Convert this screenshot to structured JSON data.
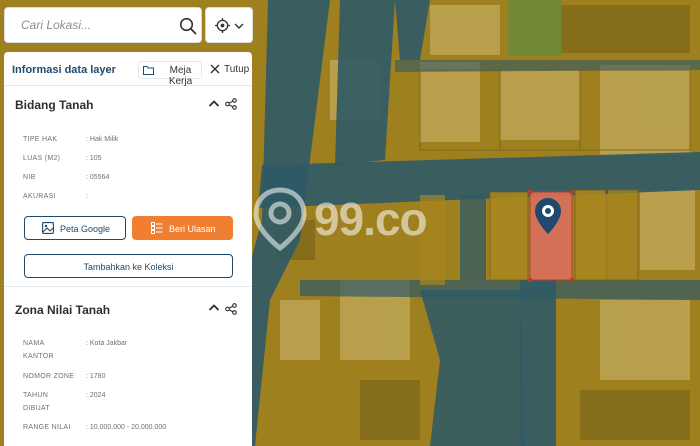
{
  "search": {
    "placeholder": "Cari Lokasi..."
  },
  "panel": {
    "title": "Informasi data layer",
    "workspace_label": "Meja Kerja",
    "close_label": "Tutup"
  },
  "land_parcel": {
    "title": "Bidang Tanah",
    "fields": [
      {
        "label": "TIPE HAK",
        "value": ": Hak Milik"
      },
      {
        "label": "LUAS (M2)",
        "value": ": 105"
      },
      {
        "label": "NIB",
        "value": ": 05564"
      },
      {
        "label": "AKURASI",
        "value": ":"
      }
    ],
    "google_maps_label": "Peta Google",
    "find_listing_label": "Beri Ulasan",
    "add_collection_label": "Tambahkan ke Koleksi"
  },
  "land_value_zone": {
    "title": "Zona Nilai Tanah",
    "fields": [
      {
        "label_1": "NAMA",
        "label_2": "KANTOR",
        "value": ": Kota Jakbar"
      },
      {
        "label_1": "NOMOR ZONE",
        "label_2": "",
        "value": ": 1780"
      },
      {
        "label_1": "TAHUN",
        "label_2": "DIBUAT",
        "value": ": 2024"
      },
      {
        "label_1": "RANGE NILAI",
        "label_2": "",
        "value": ": 10.000.000 - 20.000.000"
      }
    ]
  },
  "map": {
    "watermark": "99.co",
    "icons": {
      "search": "search-icon",
      "location": "location-target-icon",
      "pin": "map-pin-icon"
    },
    "colors": {
      "parcel_tint": "#b8901a",
      "road_tint": "#2f5a66",
      "selected_parcel": "#d9705c",
      "pin": "#1f4a6e",
      "accent_orange": "#f07f32"
    }
  }
}
